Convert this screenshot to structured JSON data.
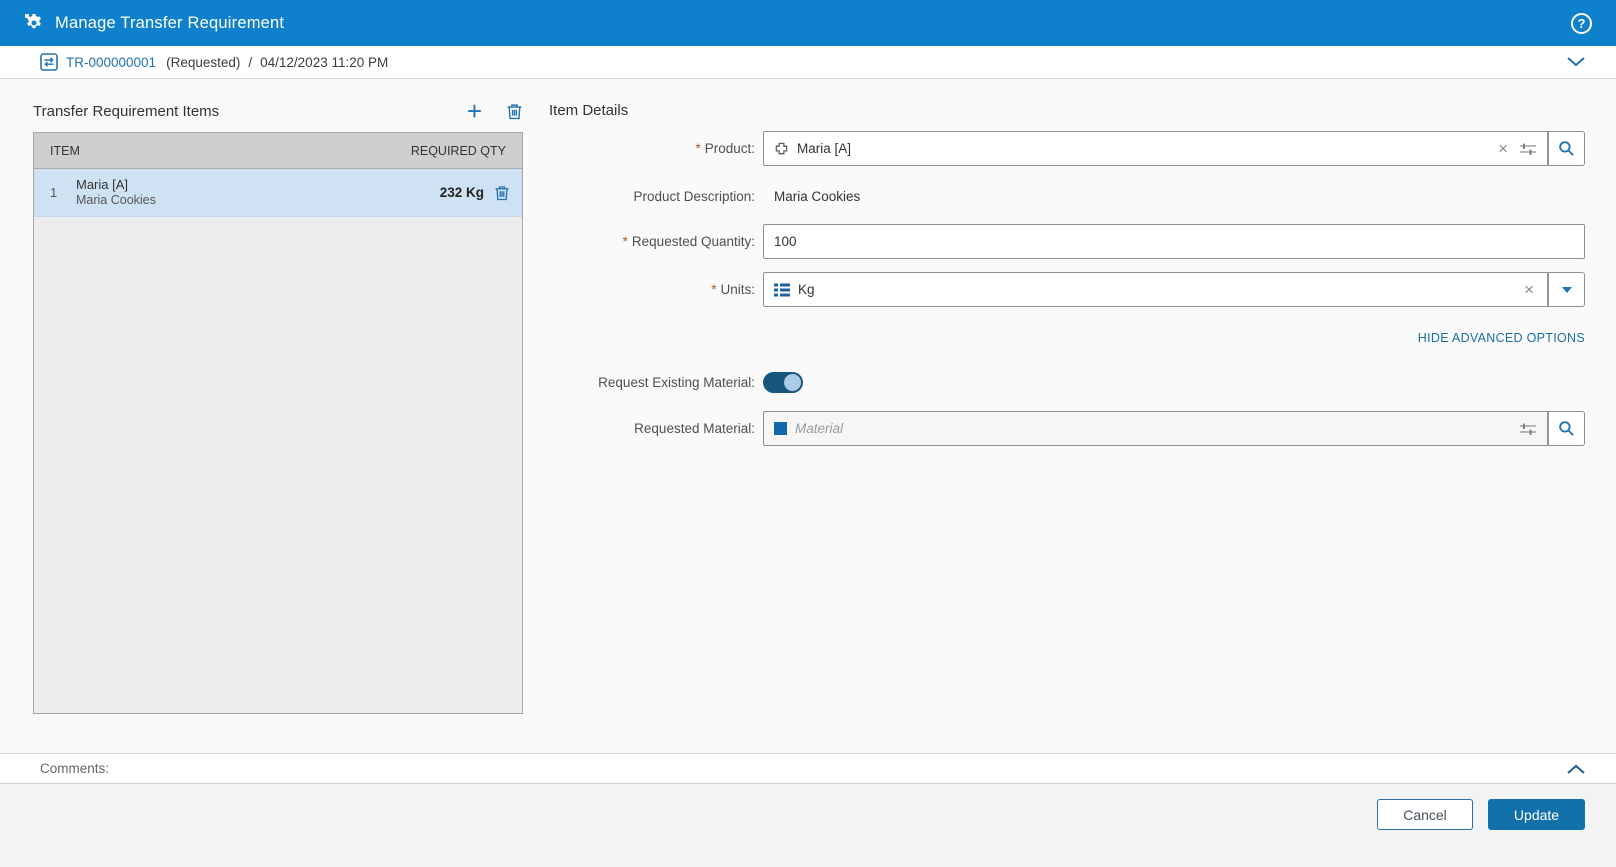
{
  "header": {
    "title": "Manage Transfer Requirement"
  },
  "breadcrumb": {
    "id": "TR-000000001",
    "status": "(Requested)",
    "separator": "/",
    "timestamp": "04/12/2023 11:20 PM"
  },
  "items_panel": {
    "title": "Transfer Requirement Items",
    "columns": [
      "ITEM",
      "REQUIRED QTY"
    ],
    "rows": [
      {
        "num": "1",
        "name": "Maria [A]",
        "description": "Maria Cookies",
        "qty": "232 Kg"
      }
    ]
  },
  "details": {
    "title": "Item Details",
    "product": {
      "required": "*",
      "label": "Product:",
      "value": "Maria [A]"
    },
    "product_description": {
      "label": "Product Description:",
      "value": "Maria Cookies"
    },
    "requested_quantity": {
      "required": "*",
      "label": "Requested Quantity:",
      "value": "100"
    },
    "units": {
      "required": "*",
      "label": "Units:",
      "value": "Kg"
    },
    "advanced_options_label": "HIDE ADVANCED OPTIONS",
    "request_existing_material": {
      "label": "Request Existing Material:",
      "state": "on"
    },
    "requested_material": {
      "label": "Requested Material:",
      "placeholder": "Material"
    }
  },
  "comments": {
    "label": "Comments:"
  },
  "footer": {
    "cancel_label": "Cancel",
    "update_label": "Update"
  },
  "colors": {
    "header_bg": "#0f81cc",
    "accent_blue": "#2272b2",
    "link_blue": "#1c6ea4",
    "selected_row_bg": "#cfe2f3",
    "required_asterisk": "#a65b28",
    "update_button_bg": "#1271ab",
    "toggle_on_bg": "#17567f"
  }
}
